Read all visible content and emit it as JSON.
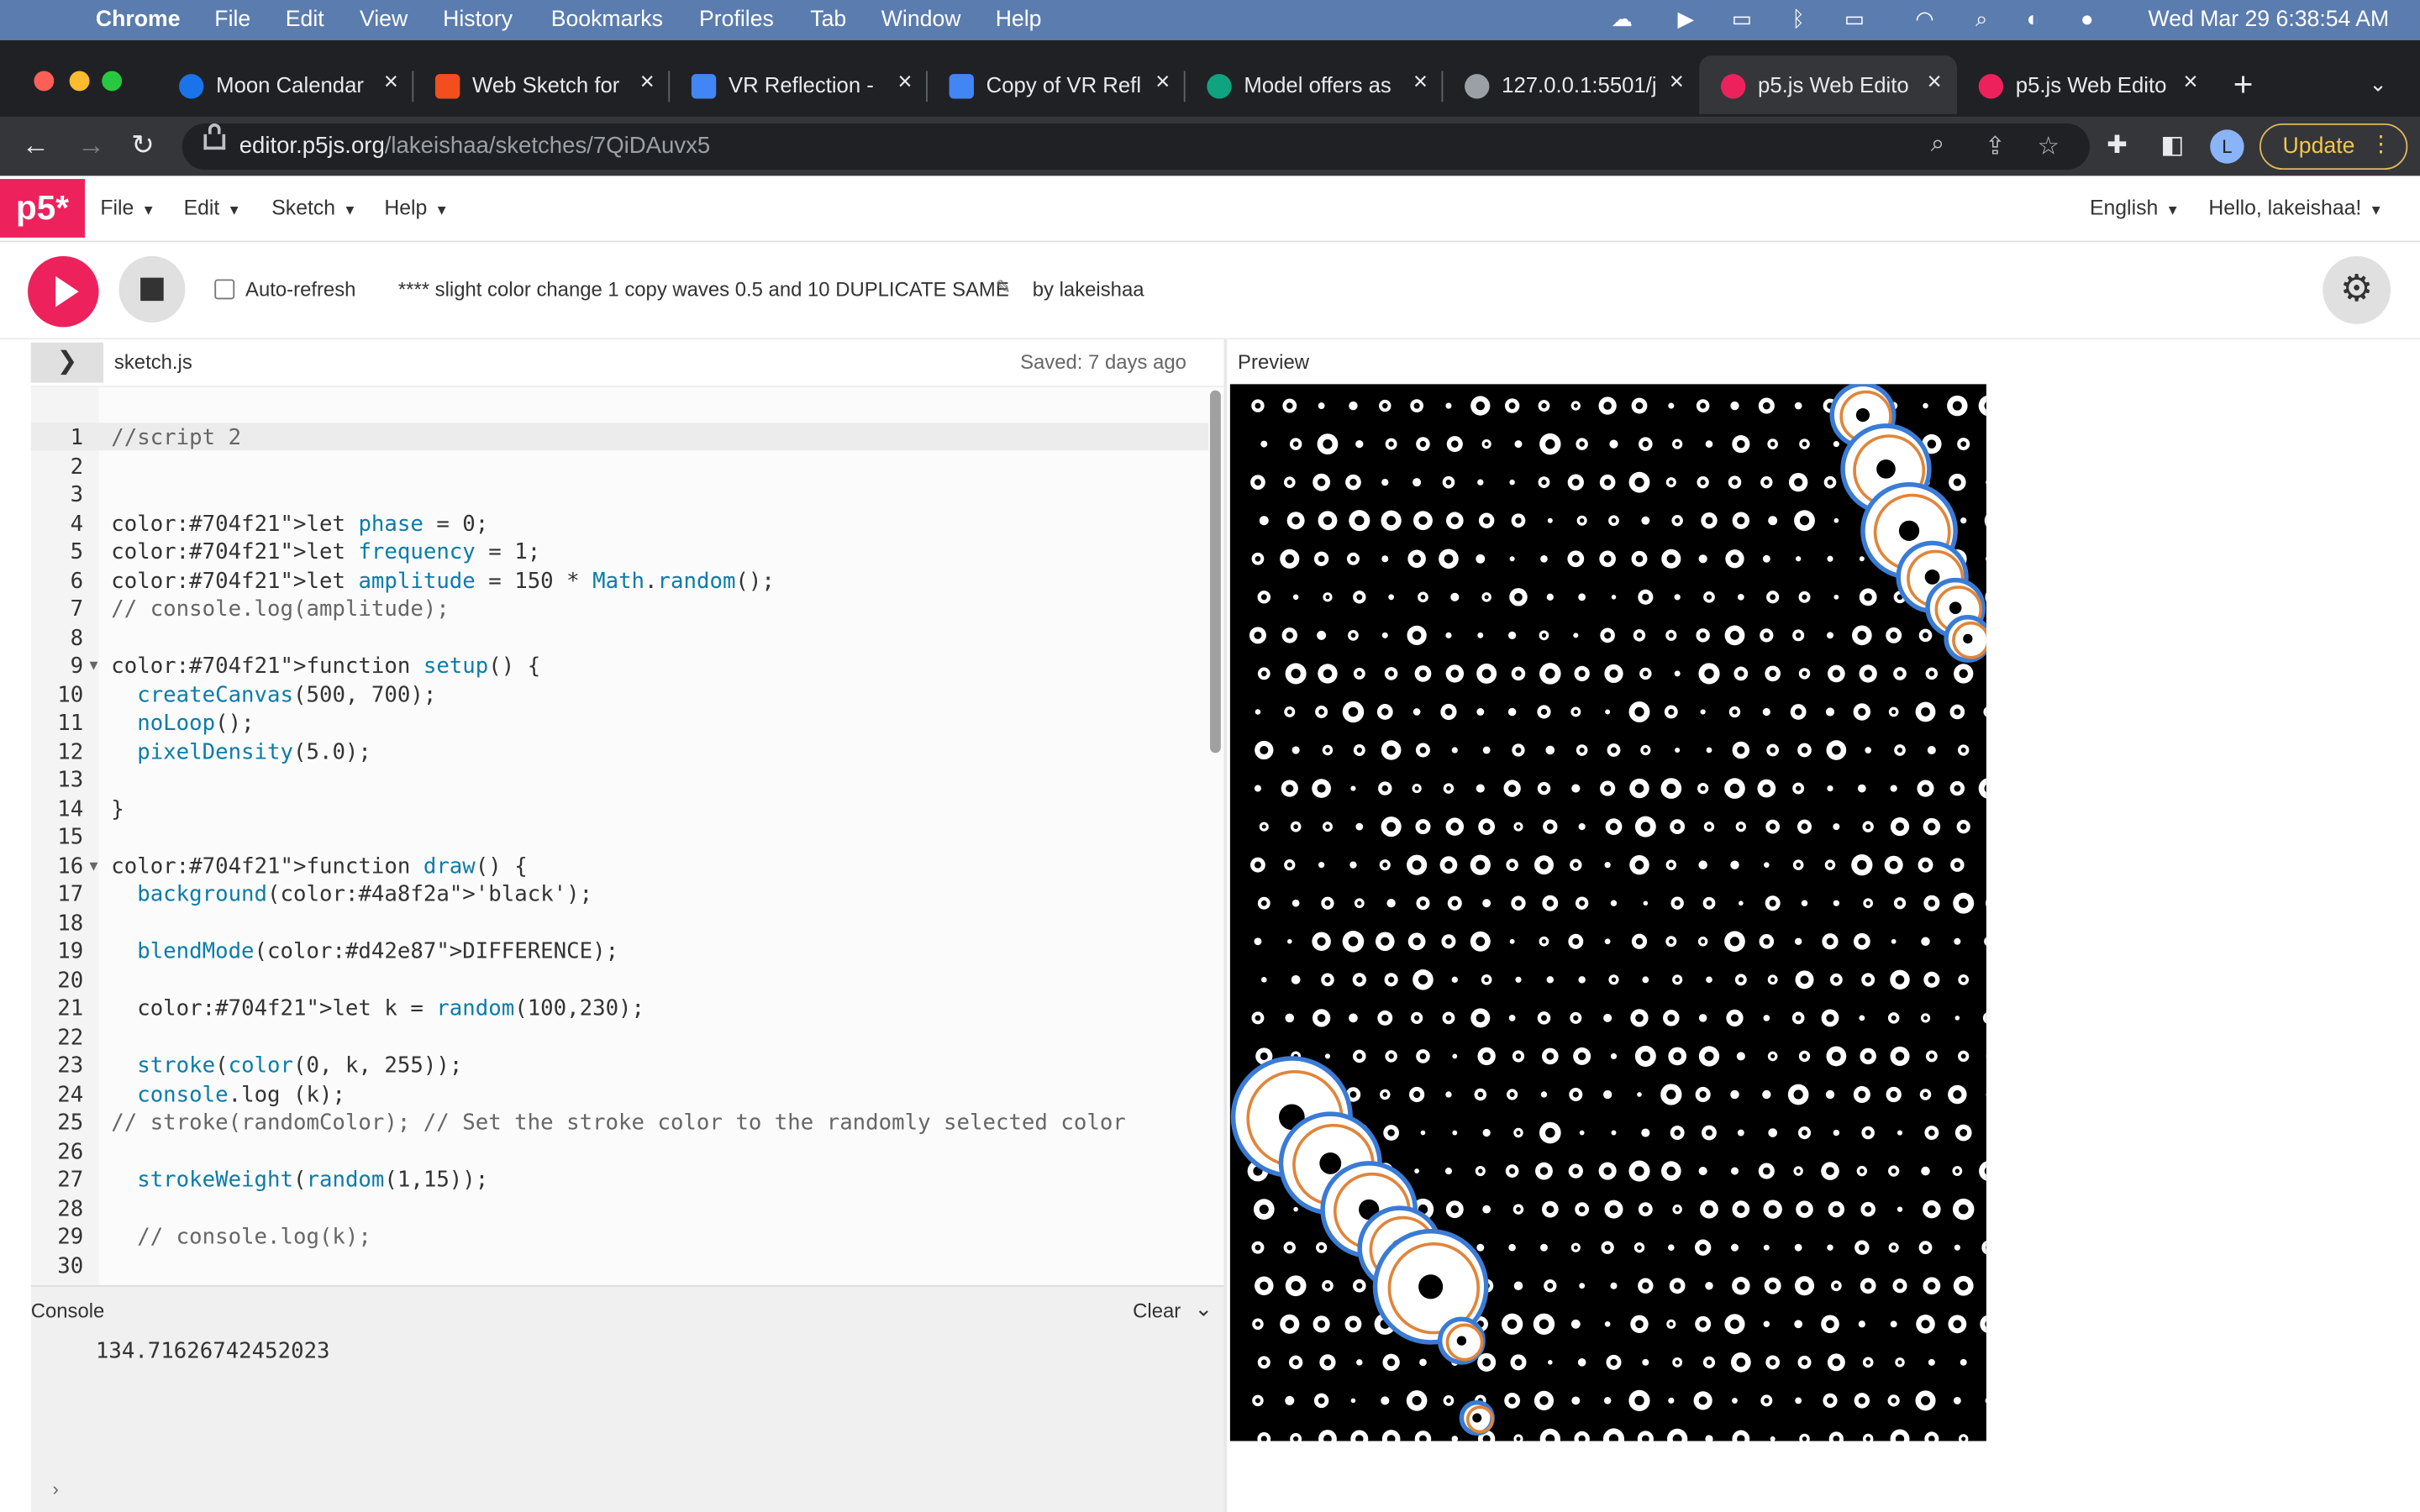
{
  "menubar": {
    "app": "Chrome",
    "items": [
      "File",
      "Edit",
      "View",
      "History",
      "Bookmarks",
      "Profiles",
      "Tab",
      "Window",
      "Help"
    ],
    "clock": "Wed Mar 29  6:38:54 AM"
  },
  "tabs": [
    {
      "title": "Moon Calendar",
      "color": "#1a73e8"
    },
    {
      "title": "Web Sketch for",
      "color": "#f24e1e"
    },
    {
      "title": "VR Reflection -",
      "color": "#4285f4"
    },
    {
      "title": "Copy of VR Refl",
      "color": "#4285f4"
    },
    {
      "title": "Model offers as",
      "color": "#10a37f"
    },
    {
      "title": "127.0.0.1:5501/j",
      "color": "#9aa0a6"
    },
    {
      "title": "p5.js Web Edito",
      "color": "#ed225d"
    },
    {
      "title": "p5.js Web Edito",
      "color": "#ed225d"
    }
  ],
  "omnibox": {
    "domain": "editor.p5js.org",
    "path": "/lakeishaa/sketches/7QiDAuvx5"
  },
  "profile": {
    "initial": "L"
  },
  "update_label": "Update",
  "p5": {
    "logo": "p5*",
    "menus": [
      "File",
      "Edit",
      "Sketch",
      "Help"
    ],
    "language": "English",
    "greeting": "Hello, lakeishaa!"
  },
  "project": {
    "auto_refresh": "Auto-refresh",
    "sketch_name": "**** slight color change 1 copy waves 0.5 and 10 DUPLICATE SAME",
    "byline": "by lakeishaa"
  },
  "editor": {
    "filename": "sketch.js",
    "saved": "Saved: 7 days ago",
    "preview_label": "Preview",
    "lines": [
      "//script 2",
      "",
      "",
      "let phase = 0;",
      "let frequency = 1;",
      "let amplitude = 150 * Math.random();",
      "// console.log(amplitude);",
      "",
      "function setup() {",
      "  createCanvas(500, 700);",
      "  noLoop();",
      "  pixelDensity(5.0);",
      "",
      "}",
      "",
      "function draw() {",
      "  background('black');",
      "",
      "  blendMode(DIFFERENCE);",
      "",
      "  let k = random(100,230);",
      "",
      "  stroke(color(0, k, 255));",
      "  console.log (k);",
      "// stroke(randomColor); // Set the stroke color to the randomly selected color",
      "",
      "  strokeWeight(random(1,15));",
      "",
      "  // console.log(k);",
      ""
    ],
    "line_numbers": [
      "1",
      "2",
      "3",
      "4",
      "5",
      "6",
      "7",
      "8",
      "9",
      "10",
      "11",
      "12",
      "13",
      "14",
      "15",
      "16",
      "17",
      "18",
      "19",
      "20",
      "21",
      "22",
      "23",
      "24",
      "25",
      "26",
      "27",
      "28",
      "29",
      "30"
    ]
  },
  "console": {
    "title": "Console",
    "clear_label": "Clear",
    "output": "134.71626742452023"
  },
  "icons": {
    "apple": "apple-logo-icon",
    "back": "back-arrow-icon",
    "forward": "forward-arrow-icon",
    "reload": "reload-icon",
    "settings": "gear-icon"
  }
}
